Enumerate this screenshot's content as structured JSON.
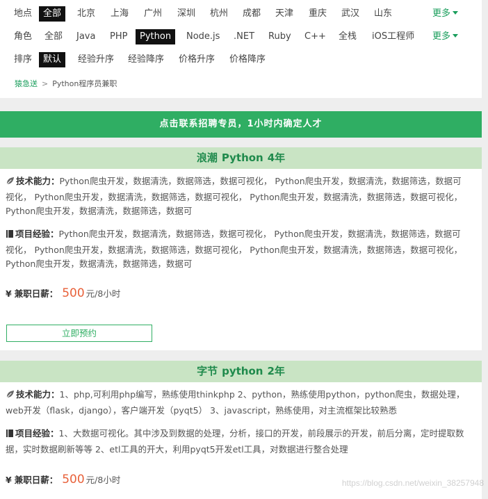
{
  "filters": {
    "location": {
      "label": "地点",
      "options": [
        "全部",
        "北京",
        "上海",
        "广州",
        "深圳",
        "杭州",
        "成都",
        "天津",
        "重庆",
        "武汉",
        "山东"
      ],
      "active": "全部",
      "more": "更多"
    },
    "role": {
      "label": "角色",
      "options": [
        "全部",
        "Java",
        "PHP",
        "Python",
        "Node.js",
        ".NET",
        "Ruby",
        "C++",
        "全栈",
        "iOS工程师"
      ],
      "active": "Python",
      "more": "更多"
    },
    "sort": {
      "label": "排序",
      "options": [
        "默认",
        "经验升序",
        "经验降序",
        "价格升序",
        "价格降序"
      ],
      "active": "默认"
    }
  },
  "breadcrumb": {
    "home": "猿急送",
    "sep": ">",
    "current": "Python程序员兼职"
  },
  "banner": {
    "text": "点击联系招聘专员，1小时内确定人才"
  },
  "cards": [
    {
      "name": "浪潮",
      "lang": "Python",
      "years": "4年",
      "skills_label": "技术能力：",
      "skills": "Python爬虫开发，数据清洗，数据筛选，数据可视化， Python爬虫开发，数据清洗，数据筛选，数据可视化， Python爬虫开发，数据清洗，数据筛选，数据可视化， Python爬虫开发，数据清洗，数据筛选，数据可视化， Python爬虫开发，数据清洗，数据筛选，数据可",
      "exp_label": "项目经验：",
      "exp": "Python爬虫开发，数据清洗，数据筛选，数据可视化， Python爬虫开发，数据清洗，数据筛选，数据可视化， Python爬虫开发，数据清洗，数据筛选，数据可视化， Python爬虫开发，数据清洗，数据筛选，数据可视化， Python爬虫开发，数据清洗，数据筛选，数据可",
      "salary_label": "兼职日薪：",
      "salary": "500",
      "salary_unit": "元/8小时",
      "button": "立即预约"
    },
    {
      "name": "字节",
      "lang": "python",
      "years": "2年",
      "skills_label": "技术能力：",
      "skills": "1、php,可利用php编写，熟练使用thinkphp 2、python，熟练使用python，python爬虫，数据处理，web开发（flask，django），客户端开发（pyqt5） 3、javascript，熟练使用，对主流框架比较熟悉",
      "exp_label": "项目经验：",
      "exp": "1、大数据可视化。其中涉及到数据的处理，分析，接口的开发，前段展示的开发，前后分离，定时提取数据，实时数据刷新等等 2、etl工具的开大，利用pyqt5开发etl工具，对数据进行整合处理",
      "salary_label": "兼职日薪：",
      "salary": "500",
      "salary_unit": "元/8小时"
    }
  ],
  "icons": {
    "skill": "leaf-icon",
    "project": "notebook-icon",
    "salary": "yen-icon"
  },
  "colors": {
    "accent": "#2fae63",
    "card_header_bg": "#c9e4c4",
    "price": "#e8613a",
    "active_filter_bg": "#111111"
  },
  "watermark": "https://blog.csdn.net/weixin_38257948"
}
